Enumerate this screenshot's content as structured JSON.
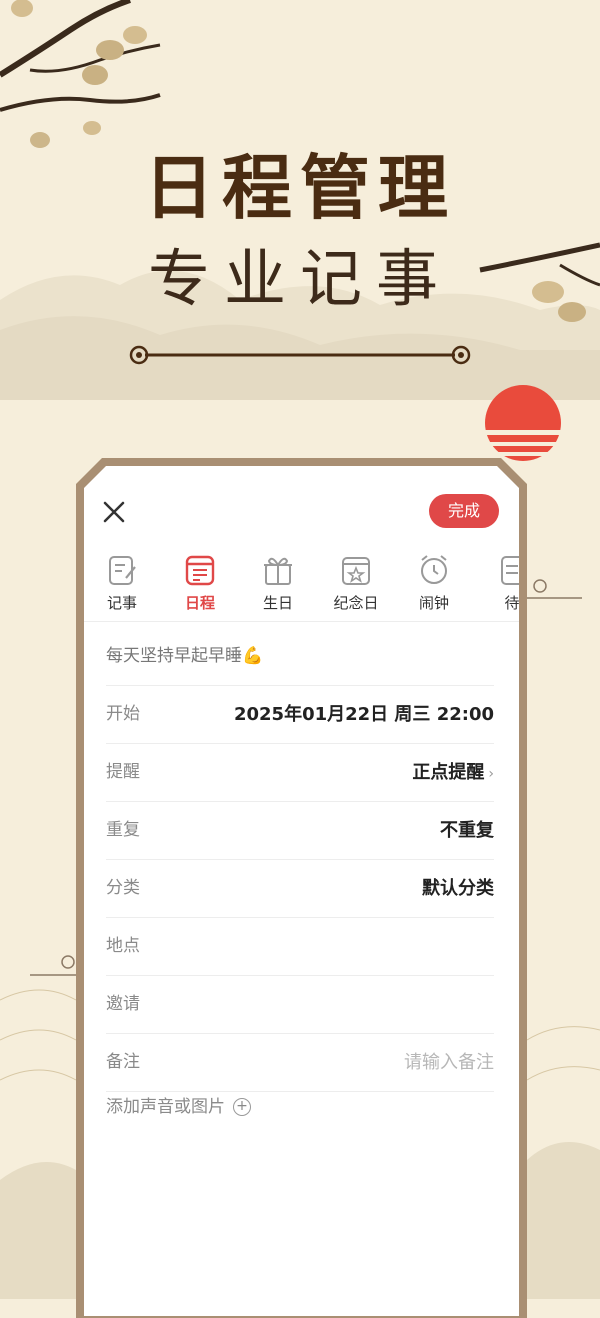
{
  "promo": {
    "title": "日程管理",
    "subtitle": "专业记事"
  },
  "editor": {
    "close_icon": "close-icon",
    "done_label": "完成",
    "tabs": [
      {
        "label": "记事",
        "icon": "note-icon",
        "active": false
      },
      {
        "label": "日程",
        "icon": "calendar-icon",
        "active": true
      },
      {
        "label": "生日",
        "icon": "gift-icon",
        "active": false
      },
      {
        "label": "纪念日",
        "icon": "anniversary-icon",
        "active": false
      },
      {
        "label": "闹钟",
        "icon": "alarm-icon",
        "active": false
      },
      {
        "label": "待",
        "icon": "todo-icon",
        "active": false
      }
    ],
    "event_title": "每天坚持早起早睡💪",
    "fields": {
      "start": {
        "label": "开始",
        "value": "2025年01月22日 周三 22:00"
      },
      "reminder": {
        "label": "提醒",
        "value": "正点提醒"
      },
      "repeat": {
        "label": "重复",
        "value": "不重复"
      },
      "category": {
        "label": "分类",
        "value": "默认分类"
      },
      "location": {
        "label": "地点",
        "value": ""
      },
      "invite": {
        "label": "邀请",
        "value": ""
      },
      "note": {
        "label": "备注",
        "placeholder": "请输入备注"
      }
    },
    "add_media_label": "添加声音或图片"
  },
  "colors": {
    "accent": "#e04848",
    "title_brown": "#4a2c12",
    "background": "#f6eedb",
    "frame": "#a98f73"
  }
}
